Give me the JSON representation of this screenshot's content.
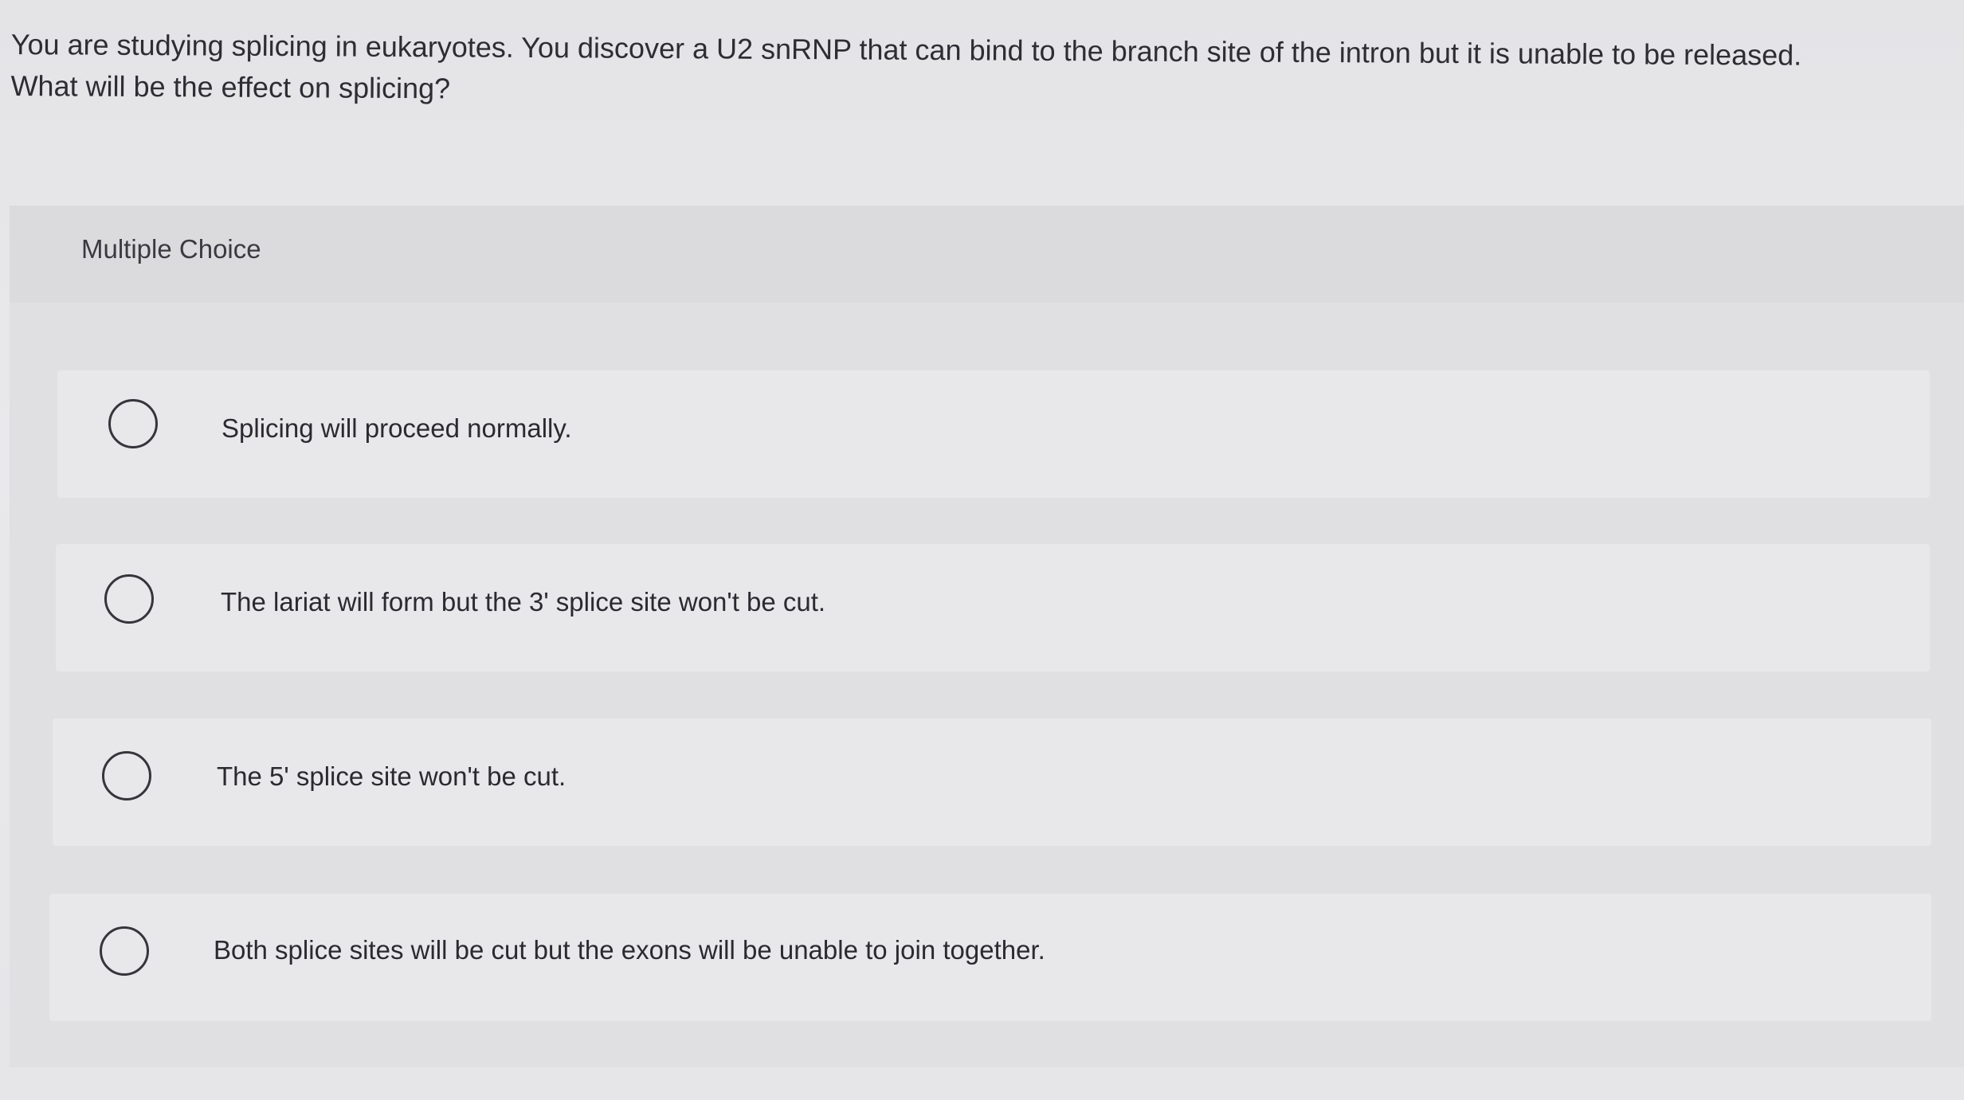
{
  "question": {
    "line1": "You are studying splicing in eukaryotes. You discover a U2 snRNP that can bind to the branch site of the intron but it is unable to be released.",
    "line2": "What will be the effect on splicing?"
  },
  "section_label": "Multiple Choice",
  "options": [
    {
      "label": "Splicing will proceed normally."
    },
    {
      "label": "The lariat will form but the 3' splice site won't be cut."
    },
    {
      "label": "The 5' splice site won't be cut."
    },
    {
      "label": "Both splice sites will be cut but the exons will be unable to join together."
    }
  ]
}
